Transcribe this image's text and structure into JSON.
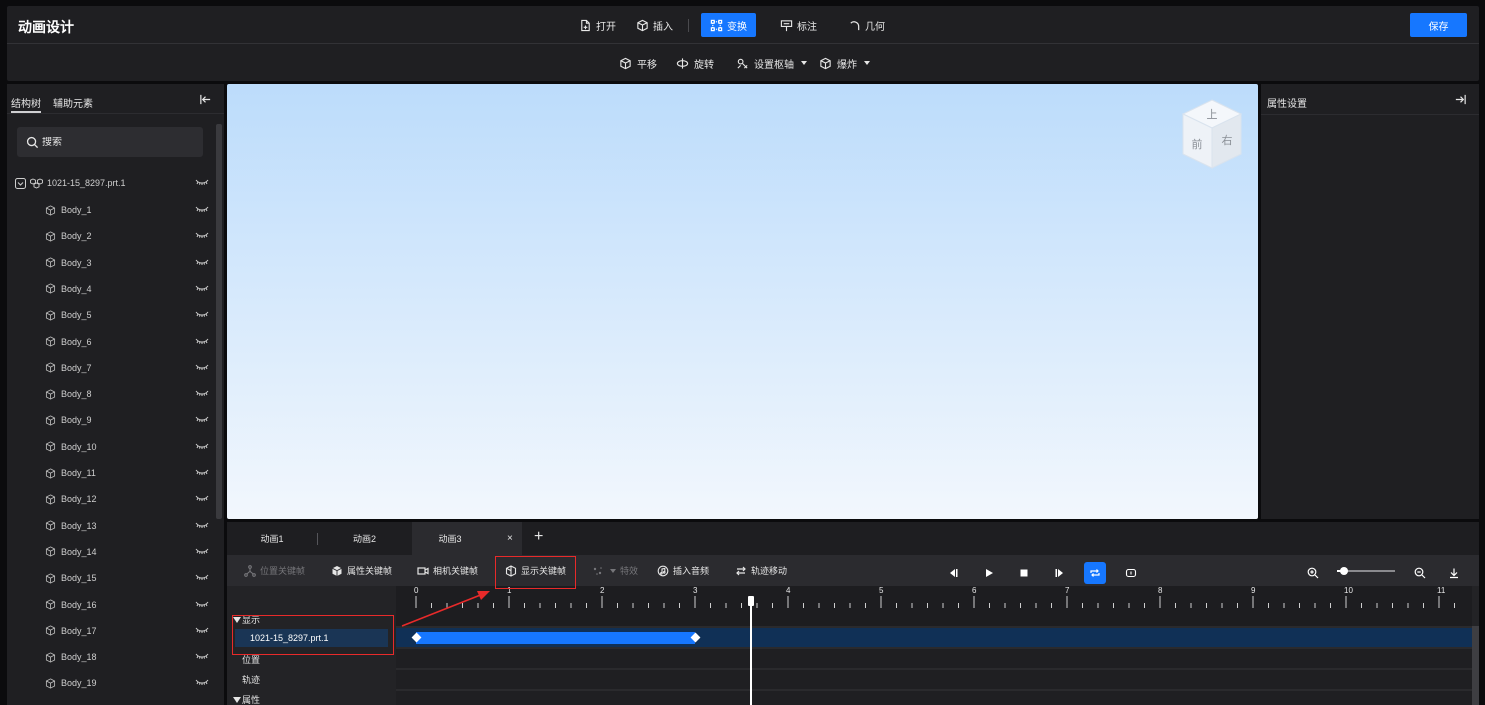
{
  "app": {
    "title": "动画设计",
    "save_label": "保存"
  },
  "menu": [
    {
      "label": "打开",
      "icon": "file-plus-icon"
    },
    {
      "label": "插入",
      "icon": "cube-icon"
    },
    {
      "label": "变换",
      "icon": "transform-icon",
      "active": true
    },
    {
      "label": "标注",
      "icon": "annotation-icon"
    },
    {
      "label": "几何",
      "icon": "arc-icon"
    }
  ],
  "tools": [
    {
      "label": "平移",
      "icon": "cube-move-icon"
    },
    {
      "label": "旋转",
      "icon": "rotate-icon"
    },
    {
      "label": "设置枢轴",
      "icon": "pivot-icon",
      "dropdown": true
    },
    {
      "label": "爆炸",
      "icon": "explode-icon",
      "dropdown": true
    }
  ],
  "left_panel": {
    "tabs": [
      "结构树",
      "辅助元素"
    ],
    "search_placeholder": "搜索",
    "root_item": "1021-15_8297.prt.1",
    "items": [
      "Body_1",
      "Body_2",
      "Body_3",
      "Body_4",
      "Body_5",
      "Body_6",
      "Body_7",
      "Body_8",
      "Body_9",
      "Body_10",
      "Body_11",
      "Body_12",
      "Body_13",
      "Body_14",
      "Body_15",
      "Body_16",
      "Body_17",
      "Body_18",
      "Body_19"
    ]
  },
  "viewcube": {
    "top": "上",
    "front": "前",
    "right": "右"
  },
  "right_panel": {
    "title": "属性设置"
  },
  "animation": {
    "tabs": [
      "动画1",
      "动画2",
      "动画3"
    ],
    "close_glyph": "×",
    "add_glyph": "+",
    "keyframe_tools": [
      {
        "label": "位置关键帧",
        "disabled": true
      },
      {
        "label": "属性关键帧"
      },
      {
        "label": "相机关键帧"
      },
      {
        "label": "显示关键帧",
        "highlighted": true
      },
      {
        "label": "特效",
        "disabled": true
      },
      {
        "label": "插入音频"
      },
      {
        "label": "轨迹移动"
      }
    ],
    "track_groups": {
      "display": "显示",
      "selected_track": "1021-15_8297.prt.1",
      "position": "位置",
      "trajectory": "轨迹",
      "attribute": "属性"
    },
    "ruler": [
      "0",
      "1",
      "2",
      "3",
      "4",
      "5",
      "6",
      "7",
      "8",
      "9",
      "10",
      "11"
    ],
    "zoom_level": 0.12,
    "playhead_time": 3.6,
    "keyframes": {
      "start": 0,
      "end": 3
    }
  },
  "colors": {
    "accent": "#1677ff",
    "highlight": "#e82a2a",
    "panel": "#1f1f22"
  }
}
